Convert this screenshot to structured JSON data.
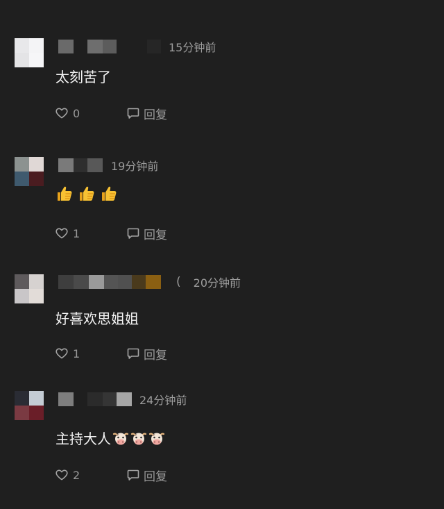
{
  "comments": [
    {
      "time": "15分钟前",
      "text": "太刻苦了",
      "emojis": [],
      "likes": "0",
      "reply_label": "回复"
    },
    {
      "time": "19分钟前",
      "text": "",
      "emojis": [
        "thumbs-up-emoji",
        "thumbs-up-emoji",
        "thumbs-up-emoji"
      ],
      "likes": "1",
      "reply_label": "回复"
    },
    {
      "time": "20分钟前",
      "paren": "(",
      "text": "好喜欢思姐姐",
      "emojis": [],
      "likes": "1",
      "reply_label": "回复"
    },
    {
      "time": "24分钟前",
      "text": "主持大人",
      "emojis": [
        "cow-face-emoji",
        "cow-face-emoji",
        "cow-face-emoji"
      ],
      "likes": "2",
      "reply_label": "回复"
    }
  ],
  "colors": {
    "background": "#1f1f1f",
    "text": "#f4f4f4",
    "secondary": "#9c9c9c"
  }
}
